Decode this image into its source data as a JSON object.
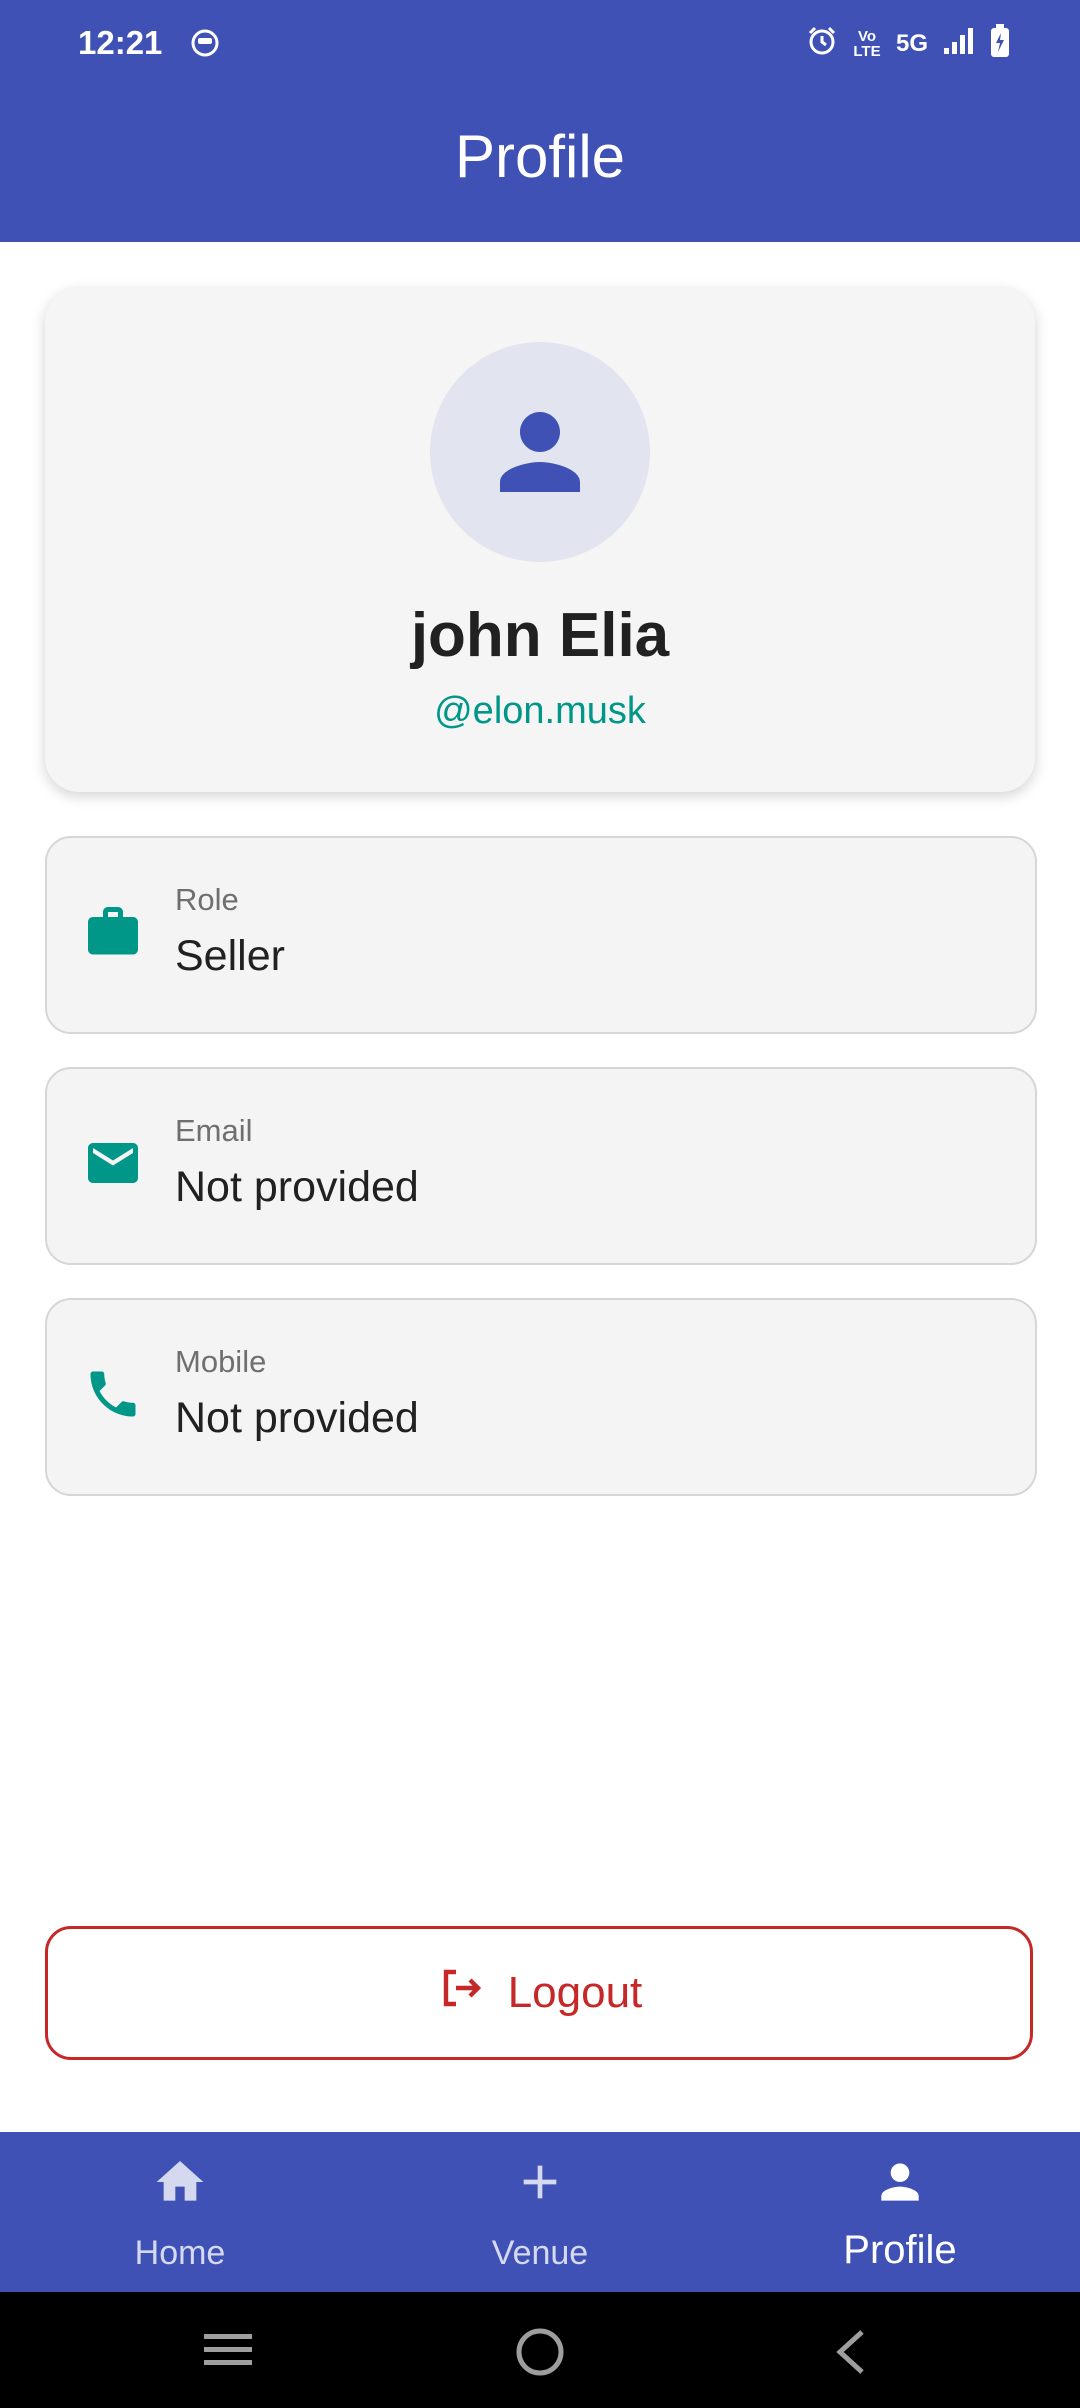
{
  "status_bar": {
    "time": "12:21",
    "network": "5G",
    "volte": "Vo LTE"
  },
  "header": {
    "title": "Profile"
  },
  "profile": {
    "name": "john Elia",
    "handle": "@elon.musk"
  },
  "info": [
    {
      "label": "Role",
      "value": "Seller",
      "icon": "briefcase-icon"
    },
    {
      "label": "Email",
      "value": "Not provided",
      "icon": "email-icon"
    },
    {
      "label": "Mobile",
      "value": "Not provided",
      "icon": "phone-icon"
    }
  ],
  "logout": {
    "label": "Logout",
    "icon": "logout-icon"
  },
  "nav": {
    "items": [
      {
        "label": "Home",
        "icon": "home-icon"
      },
      {
        "label": "Venue",
        "icon": "plus-icon"
      },
      {
        "label": "Profile",
        "icon": "person-icon"
      }
    ],
    "active": "Profile"
  },
  "colors": {
    "primary": "#3f51b5",
    "accent": "#009688",
    "danger": "#c62828"
  }
}
